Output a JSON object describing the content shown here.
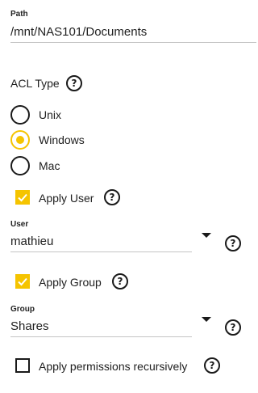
{
  "path": {
    "label": "Path",
    "value": "/mnt/NAS101/Documents"
  },
  "acl_type": {
    "label": "ACL Type",
    "options": [
      {
        "label": "Unix",
        "selected": false
      },
      {
        "label": "Windows",
        "selected": true
      },
      {
        "label": "Mac",
        "selected": false
      }
    ]
  },
  "apply_user": {
    "label": "Apply User",
    "checked": true
  },
  "user": {
    "label": "User",
    "value": "mathieu"
  },
  "apply_group": {
    "label": "Apply Group",
    "checked": true
  },
  "group": {
    "label": "Group",
    "value": "Shares"
  },
  "recursive": {
    "label": "Apply permissions recursively",
    "checked": false
  },
  "help_glyph": "?",
  "colors": {
    "accent": "#f5c400",
    "text": "#212121",
    "underline": "#c4c4c4"
  },
  "icons": {
    "help": "help-circle-icon",
    "dropdown": "caret-down-icon",
    "check": "check-icon"
  }
}
